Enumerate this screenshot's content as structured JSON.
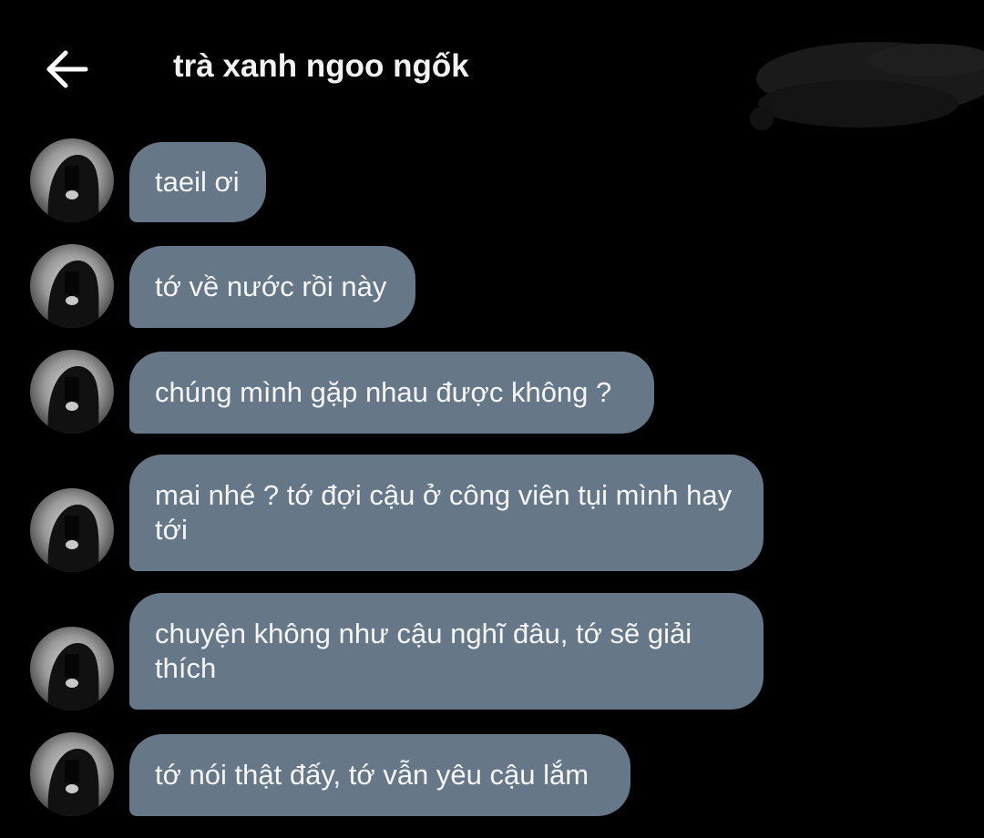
{
  "header": {
    "title": "trà xanh ngoo ngốk",
    "back_icon": "arrow-left-icon"
  },
  "colors": {
    "background": "#000000",
    "bubble": "#667788",
    "text": "#f4f6f8"
  },
  "messages": [
    {
      "text": "taeil ơi"
    },
    {
      "text": "tớ về nước rồi này"
    },
    {
      "text": "chúng mình gặp nhau được không ?"
    },
    {
      "text": "mai nhé ? tớ đợi cậu ở công viên tụi mình hay tới"
    },
    {
      "text": "chuyện không như cậu nghĩ đâu, tớ sẽ giải thích"
    },
    {
      "text": "tớ nói thật đấy, tớ vẫn yêu cậu lắm"
    }
  ]
}
